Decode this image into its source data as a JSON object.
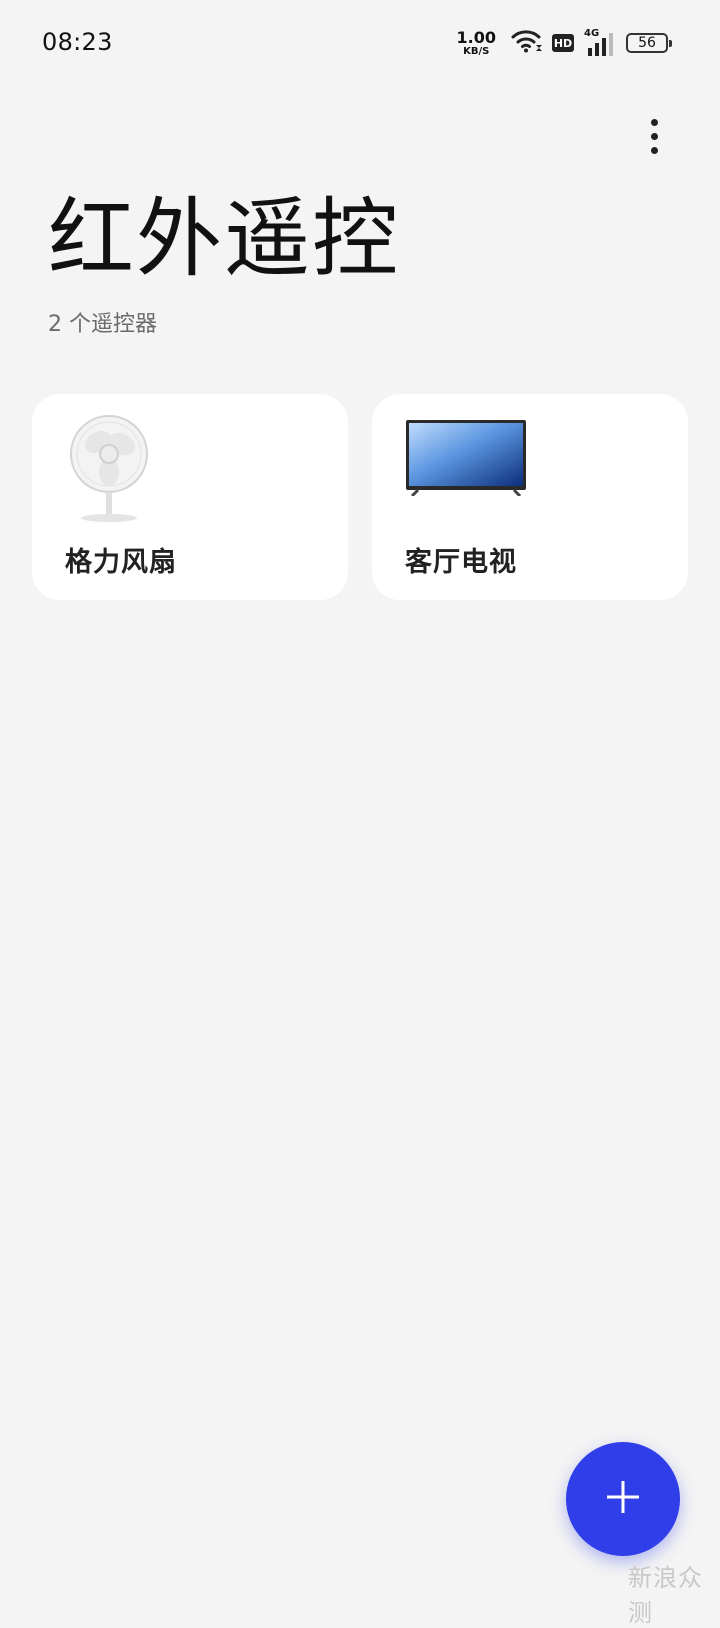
{
  "status_bar": {
    "time": "08:23",
    "net_speed_value": "1.00",
    "net_speed_unit": "KB/S",
    "hd_label": "HD",
    "network_type": "4G",
    "battery_level": "56",
    "icons": [
      "wifi-icon",
      "hd-icon",
      "cellular-signal-icon",
      "battery-icon"
    ]
  },
  "header": {
    "title": "红外遥控",
    "subtitle": "2 个遥控器",
    "menu_icon": "more-vertical-icon"
  },
  "remotes": [
    {
      "label": "格力风扇",
      "icon": "fan-icon"
    },
    {
      "label": "客厅电视",
      "icon": "tv-icon"
    }
  ],
  "fab": {
    "icon": "plus-icon",
    "color": "#2f3ee8"
  },
  "watermark": "新浪众测",
  "colors": {
    "background": "#f4f4f4",
    "card": "#ffffff",
    "accent": "#2f3ee8"
  }
}
